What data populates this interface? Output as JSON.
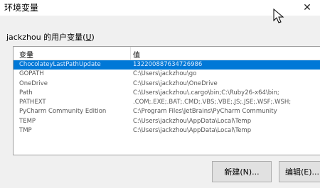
{
  "window": {
    "title": "环境变量",
    "close_glyph": "✕"
  },
  "section": {
    "label_prefix": "jackzhou 的用户变量(",
    "label_hotkey": "U",
    "label_suffix": ")"
  },
  "table": {
    "headers": {
      "name": "变量",
      "value": "值"
    },
    "rows": [
      {
        "name": "ChocolateyLastPathUpdate",
        "value": "132200887634726986",
        "selected": true
      },
      {
        "name": "GOPATH",
        "value": "C:\\Users\\jackzhou\\go",
        "selected": false
      },
      {
        "name": "OneDrive",
        "value": "C:\\Users\\jackzhou\\OneDrive",
        "selected": false
      },
      {
        "name": "Path",
        "value": "C:\\Users\\jackzhou\\.cargo\\bin;C:\\Ruby26-x64\\bin;",
        "selected": false
      },
      {
        "name": "PATHEXT",
        "value": ".COM;.EXE;.BAT;.CMD;.VBS;.VBE;.JS;.JSE;.WSF;.WSH;",
        "selected": false
      },
      {
        "name": "PyCharm Community Edition",
        "value": "C:\\Program Files\\JetBrains\\PyCharm Community",
        "selected": false
      },
      {
        "name": "TEMP",
        "value": "C:\\Users\\jackzhou\\AppData\\Local\\Temp",
        "selected": false
      },
      {
        "name": "TMP",
        "value": "C:\\Users\\jackzhou\\AppData\\Local\\Temp",
        "selected": false
      }
    ]
  },
  "buttons": {
    "new_label": "新建(N)...",
    "edit_label": "编辑(E)..."
  },
  "colors": {
    "selection": "#0078d7",
    "background": "#f0f0f0"
  }
}
